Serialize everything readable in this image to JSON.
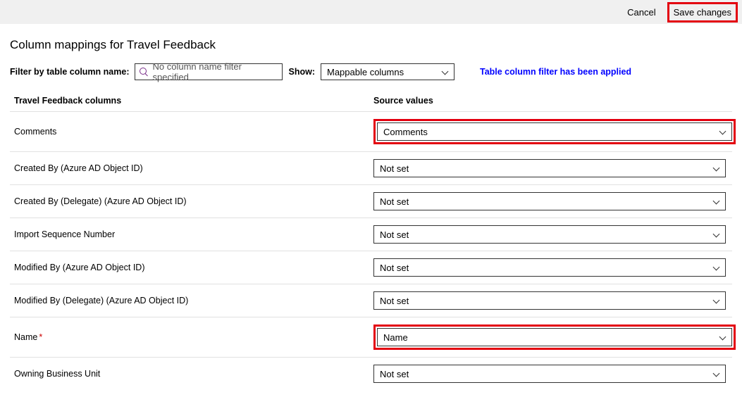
{
  "topbar": {
    "cancel": "Cancel",
    "save": "Save changes"
  },
  "page": {
    "title": "Column mappings for Travel Feedback"
  },
  "filter": {
    "label": "Filter by table column name:",
    "placeholder": "No column name filter specified",
    "show_label": "Show:",
    "show_value": "Mappable columns",
    "applied_msg": "Table column filter has been applied"
  },
  "headers": {
    "left": "Travel Feedback columns",
    "right": "Source values"
  },
  "rows": [
    {
      "label": "Comments",
      "value": "Comments",
      "required": false,
      "highlight": true
    },
    {
      "label": "Created By (Azure AD Object ID)",
      "value": "Not set",
      "required": false,
      "highlight": false
    },
    {
      "label": "Created By (Delegate) (Azure AD Object ID)",
      "value": "Not set",
      "required": false,
      "highlight": false
    },
    {
      "label": "Import Sequence Number",
      "value": "Not set",
      "required": false,
      "highlight": false
    },
    {
      "label": "Modified By (Azure AD Object ID)",
      "value": "Not set",
      "required": false,
      "highlight": false
    },
    {
      "label": "Modified By (Delegate) (Azure AD Object ID)",
      "value": "Not set",
      "required": false,
      "highlight": false
    },
    {
      "label": "Name",
      "value": "Name",
      "required": true,
      "highlight": true
    },
    {
      "label": "Owning Business Unit",
      "value": "Not set",
      "required": false,
      "highlight": false
    }
  ]
}
